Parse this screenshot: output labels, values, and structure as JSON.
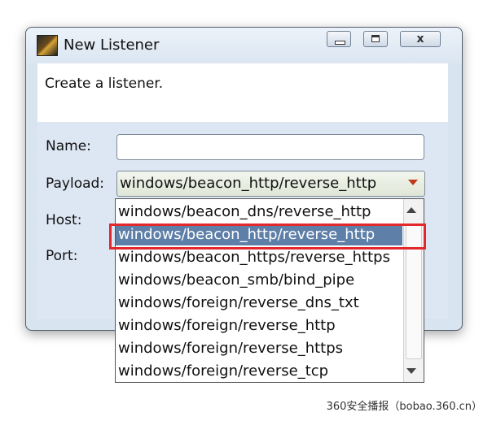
{
  "window": {
    "title": "New Listener",
    "minimize": "",
    "maximize": "",
    "close": "x"
  },
  "description": "Create a listener.",
  "form": {
    "name_label": "Name:",
    "name_value": "",
    "payload_label": "Payload:",
    "payload_value": "windows/beacon_http/reverse_http",
    "host_label": "Host:",
    "port_label": "Port:"
  },
  "dropdown": {
    "options": [
      "windows/beacon_dns/reverse_http",
      "windows/beacon_http/reverse_http",
      "windows/beacon_https/reverse_https",
      "windows/beacon_smb/bind_pipe",
      "windows/foreign/reverse_dns_txt",
      "windows/foreign/reverse_http",
      "windows/foreign/reverse_https",
      "windows/foreign/reverse_tcp"
    ],
    "selected_index": 1
  },
  "colors": {
    "selected_bg": "#5e7fa8",
    "highlight_border": "#e2272d",
    "dropdown_arrow": "#c0391b"
  },
  "watermark": "360安全播报（bobao.360.cn）"
}
